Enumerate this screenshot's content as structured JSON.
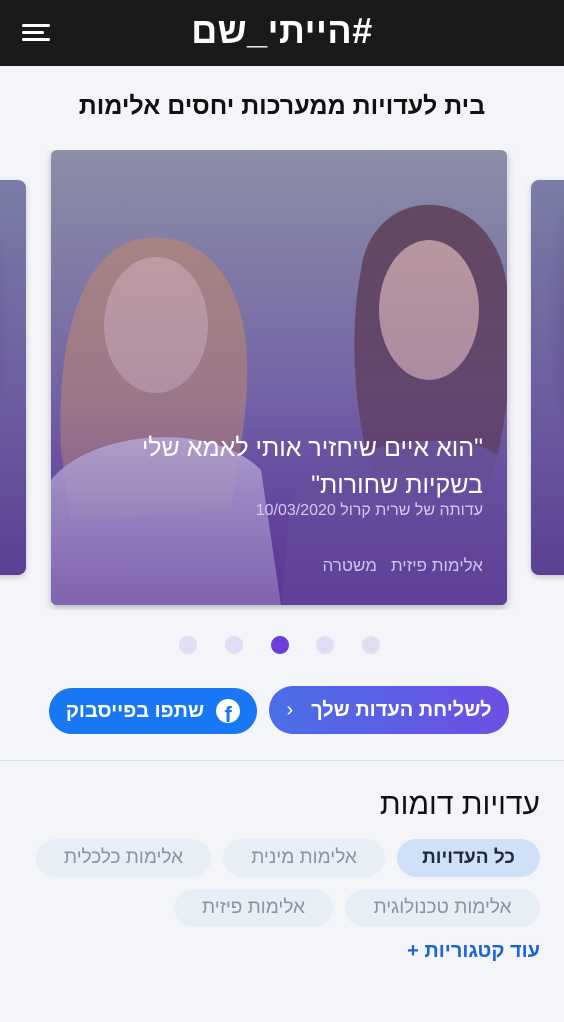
{
  "header": {
    "logo": "#הייתי_שם",
    "menu_icon": "hamburger-menu-icon"
  },
  "page": {
    "title": "בית לעדויות ממערכות יחסים אלימות"
  },
  "carousel": {
    "main_card": {
      "quote_line1": "\"הוא איים שיחזיר אותי לאמא שלי",
      "quote_line2": "בשקיות שחורות\"",
      "byline": "עדותה של שרית קרול 10/03/2020",
      "tags": [
        "אלימות פיזית",
        "משטרה"
      ]
    },
    "dots": {
      "count": 5,
      "active_index": 2
    },
    "colors": {
      "active_dot": "#6d3fd9",
      "inactive_dot": "#e2dcf4"
    }
  },
  "actions": {
    "send_label": "לשליחת העדות שלך",
    "send_icon": "chevron-left-icon",
    "share_label": "שתפו בפייסבוק",
    "share_icon": "facebook-icon",
    "facebook_color": "#1877f2"
  },
  "similar": {
    "title": "עדויות דומות",
    "pills": [
      {
        "label": "כל העדויות",
        "active": true
      },
      {
        "label": "אלימות מינית",
        "active": false
      },
      {
        "label": "אלימות כלכלית",
        "active": false
      },
      {
        "label": "אלימות טכנולוגית",
        "active": false
      },
      {
        "label": "אלימות פיזית",
        "active": false
      }
    ],
    "more_label": "עוד קטגוריות +"
  }
}
